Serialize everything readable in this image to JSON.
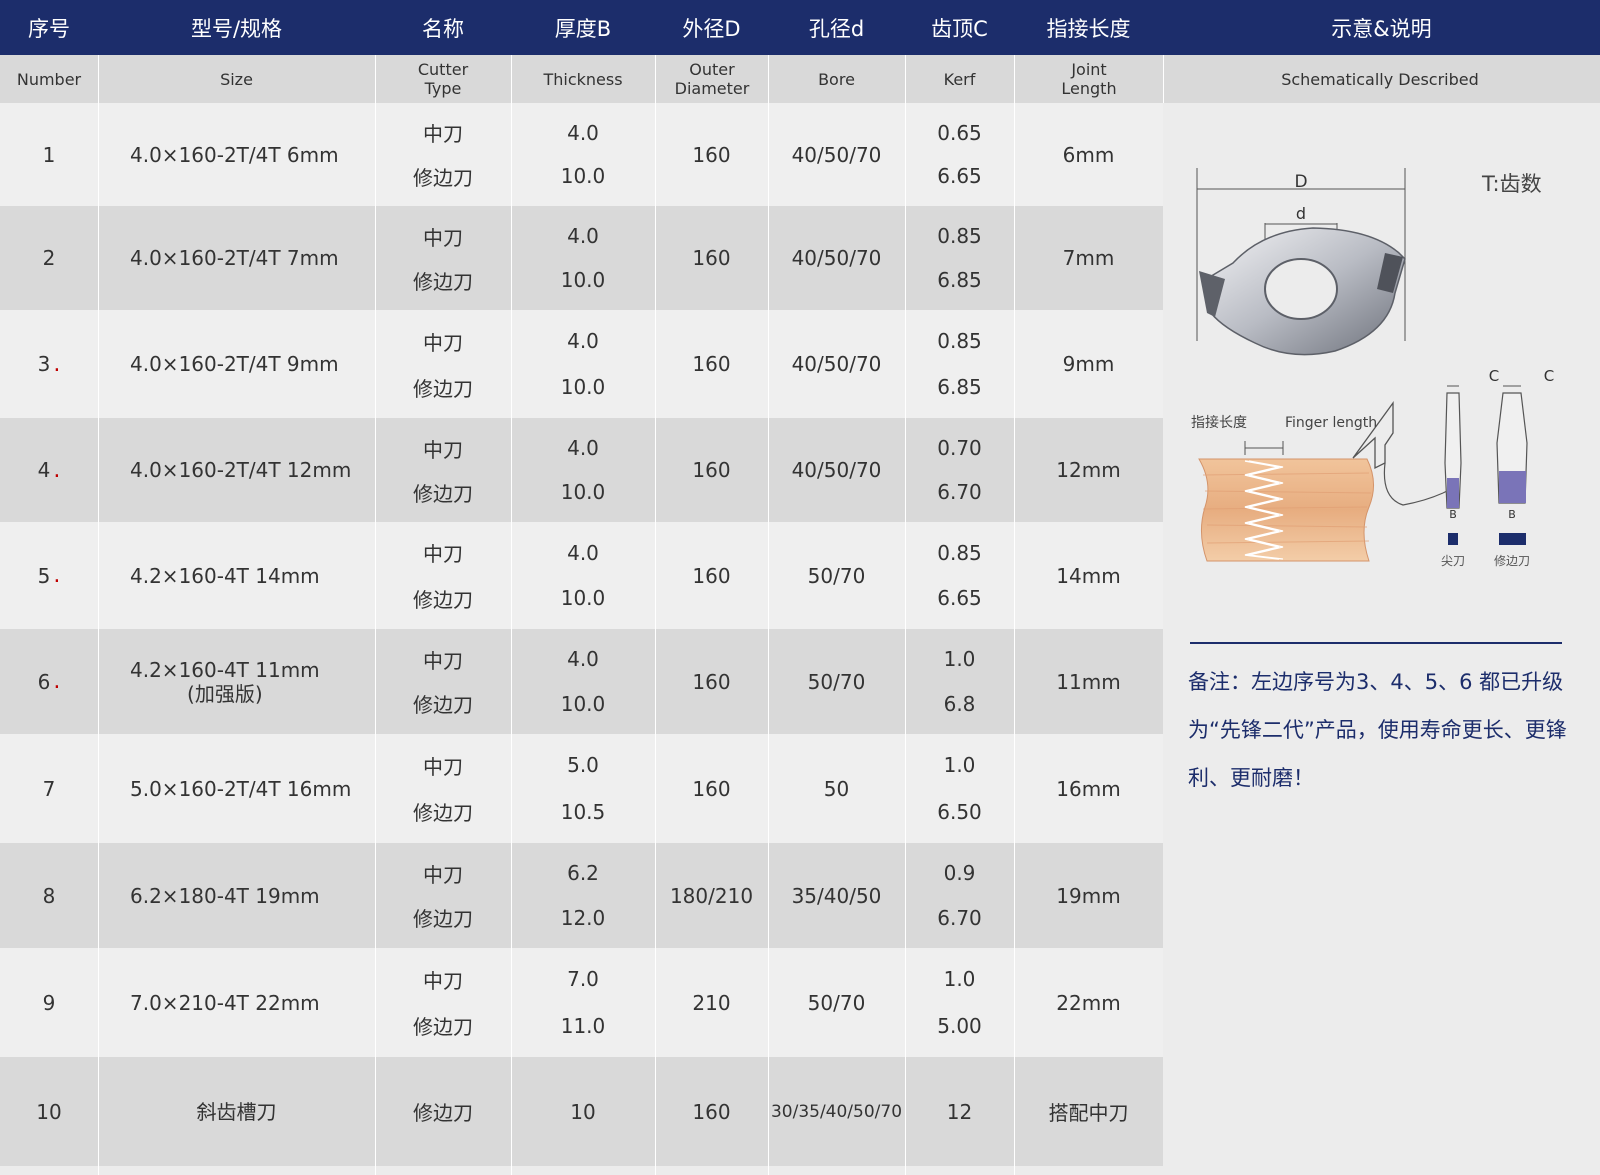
{
  "header_cn": {
    "number": "序号",
    "size": "型号/规格",
    "name": "名称",
    "thickness": "厚度B",
    "outer": "外径D",
    "bore": "孔径d",
    "kerf": "齿顶C",
    "joint": "指接长度",
    "schematic": "示意&说明"
  },
  "header_en": {
    "number": "Number",
    "size": "Size",
    "cutter": "Cutter Type",
    "thickness": "Thickness",
    "outer": "Outer Diameter",
    "bore": "Bore",
    "kerf": "Kerf",
    "joint": "Joint Length",
    "schematic": "Schematically Described"
  },
  "rows": [
    {
      "no": "1",
      "size": "4.0×160-2T/4T 6mm",
      "size2": "",
      "dot": false,
      "names": [
        "中刀",
        "修边刀"
      ],
      "thick": [
        "4.0",
        "10.0"
      ],
      "outer": "160",
      "bore": "40/50/70",
      "kerf": [
        "0.65",
        "6.65"
      ],
      "joint": "6mm"
    },
    {
      "no": "2",
      "size": "4.0×160-2T/4T 7mm",
      "size2": "",
      "dot": false,
      "names": [
        "中刀",
        "修边刀"
      ],
      "thick": [
        "4.0",
        "10.0"
      ],
      "outer": "160",
      "bore": "40/50/70",
      "kerf": [
        "0.85",
        "6.85"
      ],
      "joint": "7mm"
    },
    {
      "no": "3",
      "size": "4.0×160-2T/4T 9mm",
      "size2": "",
      "dot": true,
      "names": [
        "中刀",
        "修边刀"
      ],
      "thick": [
        "4.0",
        "10.0"
      ],
      "outer": "160",
      "bore": "40/50/70",
      "kerf": [
        "0.85",
        "6.85"
      ],
      "joint": "9mm"
    },
    {
      "no": "4",
      "size": "4.0×160-2T/4T 12mm",
      "size2": "",
      "dot": true,
      "names": [
        "中刀",
        "修边刀"
      ],
      "thick": [
        "4.0",
        "10.0"
      ],
      "outer": "160",
      "bore": "40/50/70",
      "kerf": [
        "0.70",
        "6.70"
      ],
      "joint": "12mm"
    },
    {
      "no": "5",
      "size": "4.2×160-4T 14mm",
      "size2": "",
      "dot": true,
      "names": [
        "中刀",
        "修边刀"
      ],
      "thick": [
        "4.0",
        "10.0"
      ],
      "outer": "160",
      "bore": "50/70",
      "kerf": [
        "0.85",
        "6.65"
      ],
      "joint": "14mm"
    },
    {
      "no": "6",
      "size": "4.2×160-4T 11mm",
      "size2": "(加强版)",
      "dot": true,
      "names": [
        "中刀",
        "修边刀"
      ],
      "thick": [
        "4.0",
        "10.0"
      ],
      "outer": "160",
      "bore": "50/70",
      "kerf": [
        "1.0",
        "6.8"
      ],
      "joint": "11mm"
    },
    {
      "no": "7",
      "size": "5.0×160-2T/4T 16mm",
      "size2": "",
      "dot": false,
      "names": [
        "中刀",
        "修边刀"
      ],
      "thick": [
        "5.0",
        "10.5"
      ],
      "outer": "160",
      "bore": "50",
      "kerf": [
        "1.0",
        "6.50"
      ],
      "joint": "16mm"
    },
    {
      "no": "8",
      "size": "6.2×180-4T 19mm",
      "size2": "",
      "dot": false,
      "names": [
        "中刀",
        "修边刀"
      ],
      "thick": [
        "6.2",
        "12.0"
      ],
      "outer": "180/210",
      "bore": "35/40/50",
      "kerf": [
        "0.9",
        "6.70"
      ],
      "joint": "19mm"
    },
    {
      "no": "9",
      "size": "7.0×210-4T 22mm",
      "size2": "",
      "dot": false,
      "names": [
        "中刀",
        "修边刀"
      ],
      "thick": [
        "7.0",
        "11.0"
      ],
      "outer": "210",
      "bore": "50/70",
      "kerf": [
        "1.0",
        "5.00"
      ],
      "joint": "22mm"
    },
    {
      "no": "10",
      "size": "斜齿槽刀",
      "size2": "",
      "dot": false,
      "names": [
        "修边刀"
      ],
      "thick": [
        "10"
      ],
      "outer": "160",
      "bore": "30/35/40/50/70",
      "kerf": [
        "12"
      ],
      "joint": "搭配中刀"
    }
  ],
  "schematic": {
    "label_D": "D",
    "label_d": "d",
    "teeth_note": "T:齿数",
    "finger_cn": "指接长度",
    "finger_en": "Finger length",
    "label_C": "C",
    "label_B": "B",
    "tip_cutter": "尖刀",
    "trim_cutter": "修边刀"
  },
  "note": "备注：左边序号为3、4、5、6 都已升级为“先锋二代”产品，使用寿命更长、更锋利、更耐磨！",
  "colors": {
    "header": "#1c2d6b",
    "row_light": "#efefef",
    "row_dark": "#d9d9d9",
    "dot": "#c00000",
    "note": "#1c2d6b"
  }
}
